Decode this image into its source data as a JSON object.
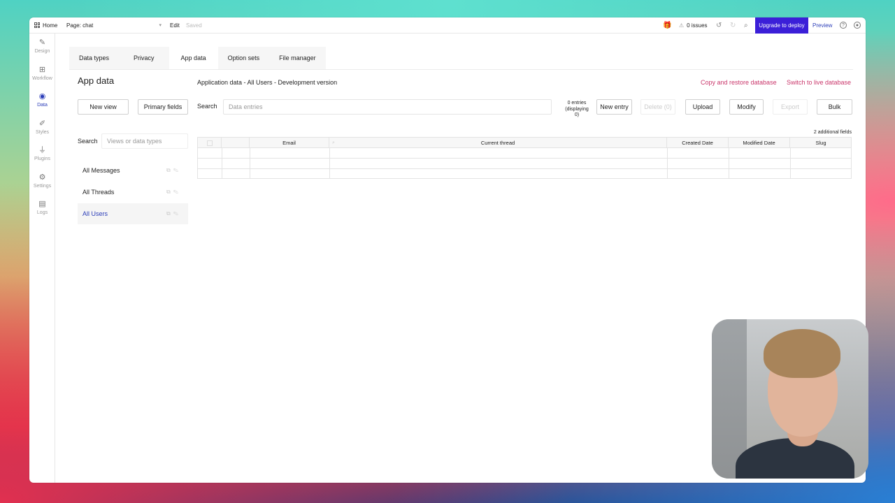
{
  "topbar": {
    "home_label": "Home",
    "page_label": "Page: chat",
    "edit_label": "Edit",
    "saved_label": "Saved",
    "issues_label": "0 issues",
    "upgrade_label": "Upgrade to deploy",
    "preview_label": "Preview"
  },
  "sidebar": {
    "items": [
      {
        "label": "Design",
        "icon": "design-icon"
      },
      {
        "label": "Workflow",
        "icon": "workflow-icon"
      },
      {
        "label": "Data",
        "icon": "database-icon"
      },
      {
        "label": "Styles",
        "icon": "brush-icon"
      },
      {
        "label": "Plugins",
        "icon": "plug-icon"
      },
      {
        "label": "Settings",
        "icon": "gear-icon"
      },
      {
        "label": "Logs",
        "icon": "document-icon"
      }
    ],
    "active": "Data"
  },
  "tabs": [
    "Data types",
    "Privacy",
    "App data",
    "Option sets",
    "File manager"
  ],
  "active_tab": "App data",
  "panel": {
    "title": "App data",
    "new_view": "New view",
    "primary_fields": "Primary fields",
    "search_label": "Search",
    "search_placeholder": "Views or data types",
    "types": [
      "All Messages",
      "All Threads",
      "All Users"
    ],
    "active_type": "All Users"
  },
  "main": {
    "subtitle": "Application data - All Users - Development version",
    "copy_restore": "Copy and restore database",
    "switch_live": "Switch to live database",
    "search_label": "Search",
    "search_placeholder": "Data entries",
    "entries_line1": "0 entries",
    "entries_line2": "(displaying",
    "entries_line3": "0)",
    "new_entry": "New entry",
    "delete": "Delete (0)",
    "upload": "Upload",
    "modify": "Modify",
    "export": "Export",
    "bulk": "Bulk",
    "additional_fields": "2 additional fields",
    "columns": [
      "Email",
      "Current thread",
      "Created Date",
      "Modified Date",
      "Slug"
    ]
  },
  "colors": {
    "accent": "#3b1fd8",
    "link_blue": "#2b3db8",
    "link_red": "#c9356a"
  }
}
